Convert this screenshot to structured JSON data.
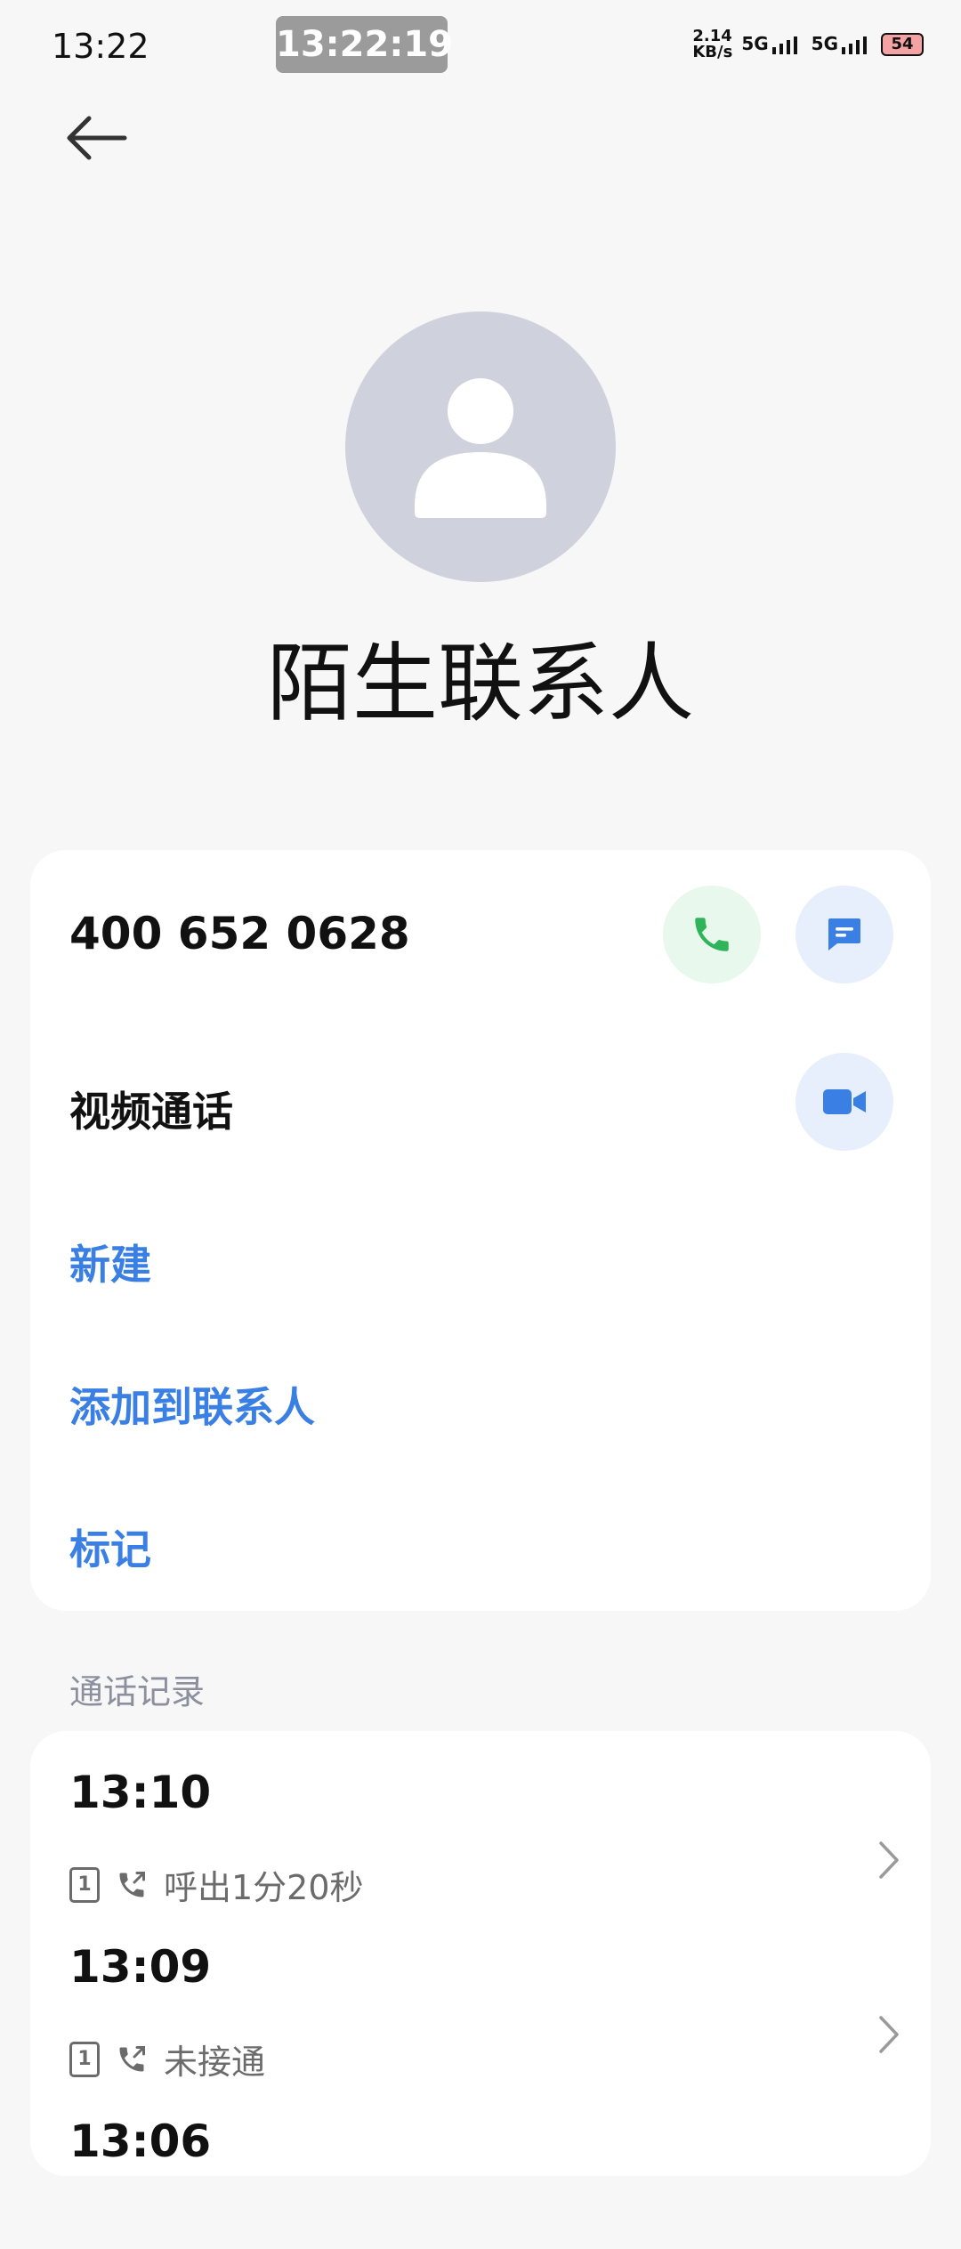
{
  "status_bar": {
    "time": "13:22",
    "overlay_time": "13:22:19",
    "net_speed_value": "2.14",
    "net_speed_unit": "KB/s",
    "network_1": "5G",
    "network_2": "5G",
    "battery": "54"
  },
  "contact": {
    "name": "陌生联系人",
    "phone": "400 652 0628"
  },
  "actions": {
    "video_call": "视频通话",
    "new": "新建",
    "add_to_contacts": "添加到联系人",
    "mark": "标记"
  },
  "call_log": {
    "title": "通话记录",
    "items": [
      {
        "time": "13:10",
        "sim": "1",
        "detail": "呼出1分20秒"
      },
      {
        "time": "13:09",
        "sim": "1",
        "detail": "未接通"
      },
      {
        "time": "13:06"
      }
    ]
  },
  "colors": {
    "accent_blue": "#3a7fe3",
    "call_green": "#2fb45a",
    "avatar_gray": "#cfd1dc"
  }
}
